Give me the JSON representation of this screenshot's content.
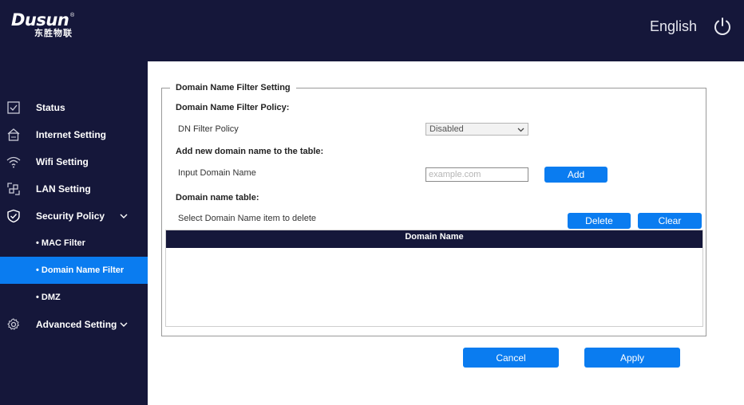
{
  "brand": {
    "name": "Dusun",
    "sub": "东胜物联",
    "reg": "®"
  },
  "header": {
    "language": "English",
    "power_icon": "power-icon"
  },
  "sidebar": {
    "items": [
      {
        "label": "Status",
        "icon": "status-check-icon"
      },
      {
        "label": "Internet Setting",
        "icon": "home-network-icon"
      },
      {
        "label": "Wifi Setting",
        "icon": "wifi-icon"
      },
      {
        "label": "LAN Setting",
        "icon": "lan-icon"
      },
      {
        "label": "Security Policy",
        "icon": "shield-check-icon",
        "expanded": true
      },
      {
        "label": "Advanced Setting",
        "icon": "gear-icon"
      }
    ],
    "sub_items": [
      {
        "label": "• MAC Filter"
      },
      {
        "label": "• Domain Name Filter",
        "active": true
      },
      {
        "label": "• DMZ"
      }
    ]
  },
  "main": {
    "legend": "Domain Name Filter Setting",
    "policy_title": "Domain Name Filter Policy:",
    "policy_label": "DN Filter Policy",
    "policy_value": "Disabled",
    "add_title": "Add new domain name to the table:",
    "input_label": "Input Domain Name",
    "input_placeholder": "example.com",
    "input_value": "",
    "add_button": "Add",
    "table_title": "Domain name table:",
    "table_hint": "Select Domain Name item to delete",
    "delete_button": "Delete",
    "clear_button": "Clear",
    "table_header": "Domain Name",
    "rows": [],
    "cancel_button": "Cancel",
    "apply_button": "Apply"
  },
  "colors": {
    "nav_bg": "#15173a",
    "accent": "#0a7cf0"
  }
}
